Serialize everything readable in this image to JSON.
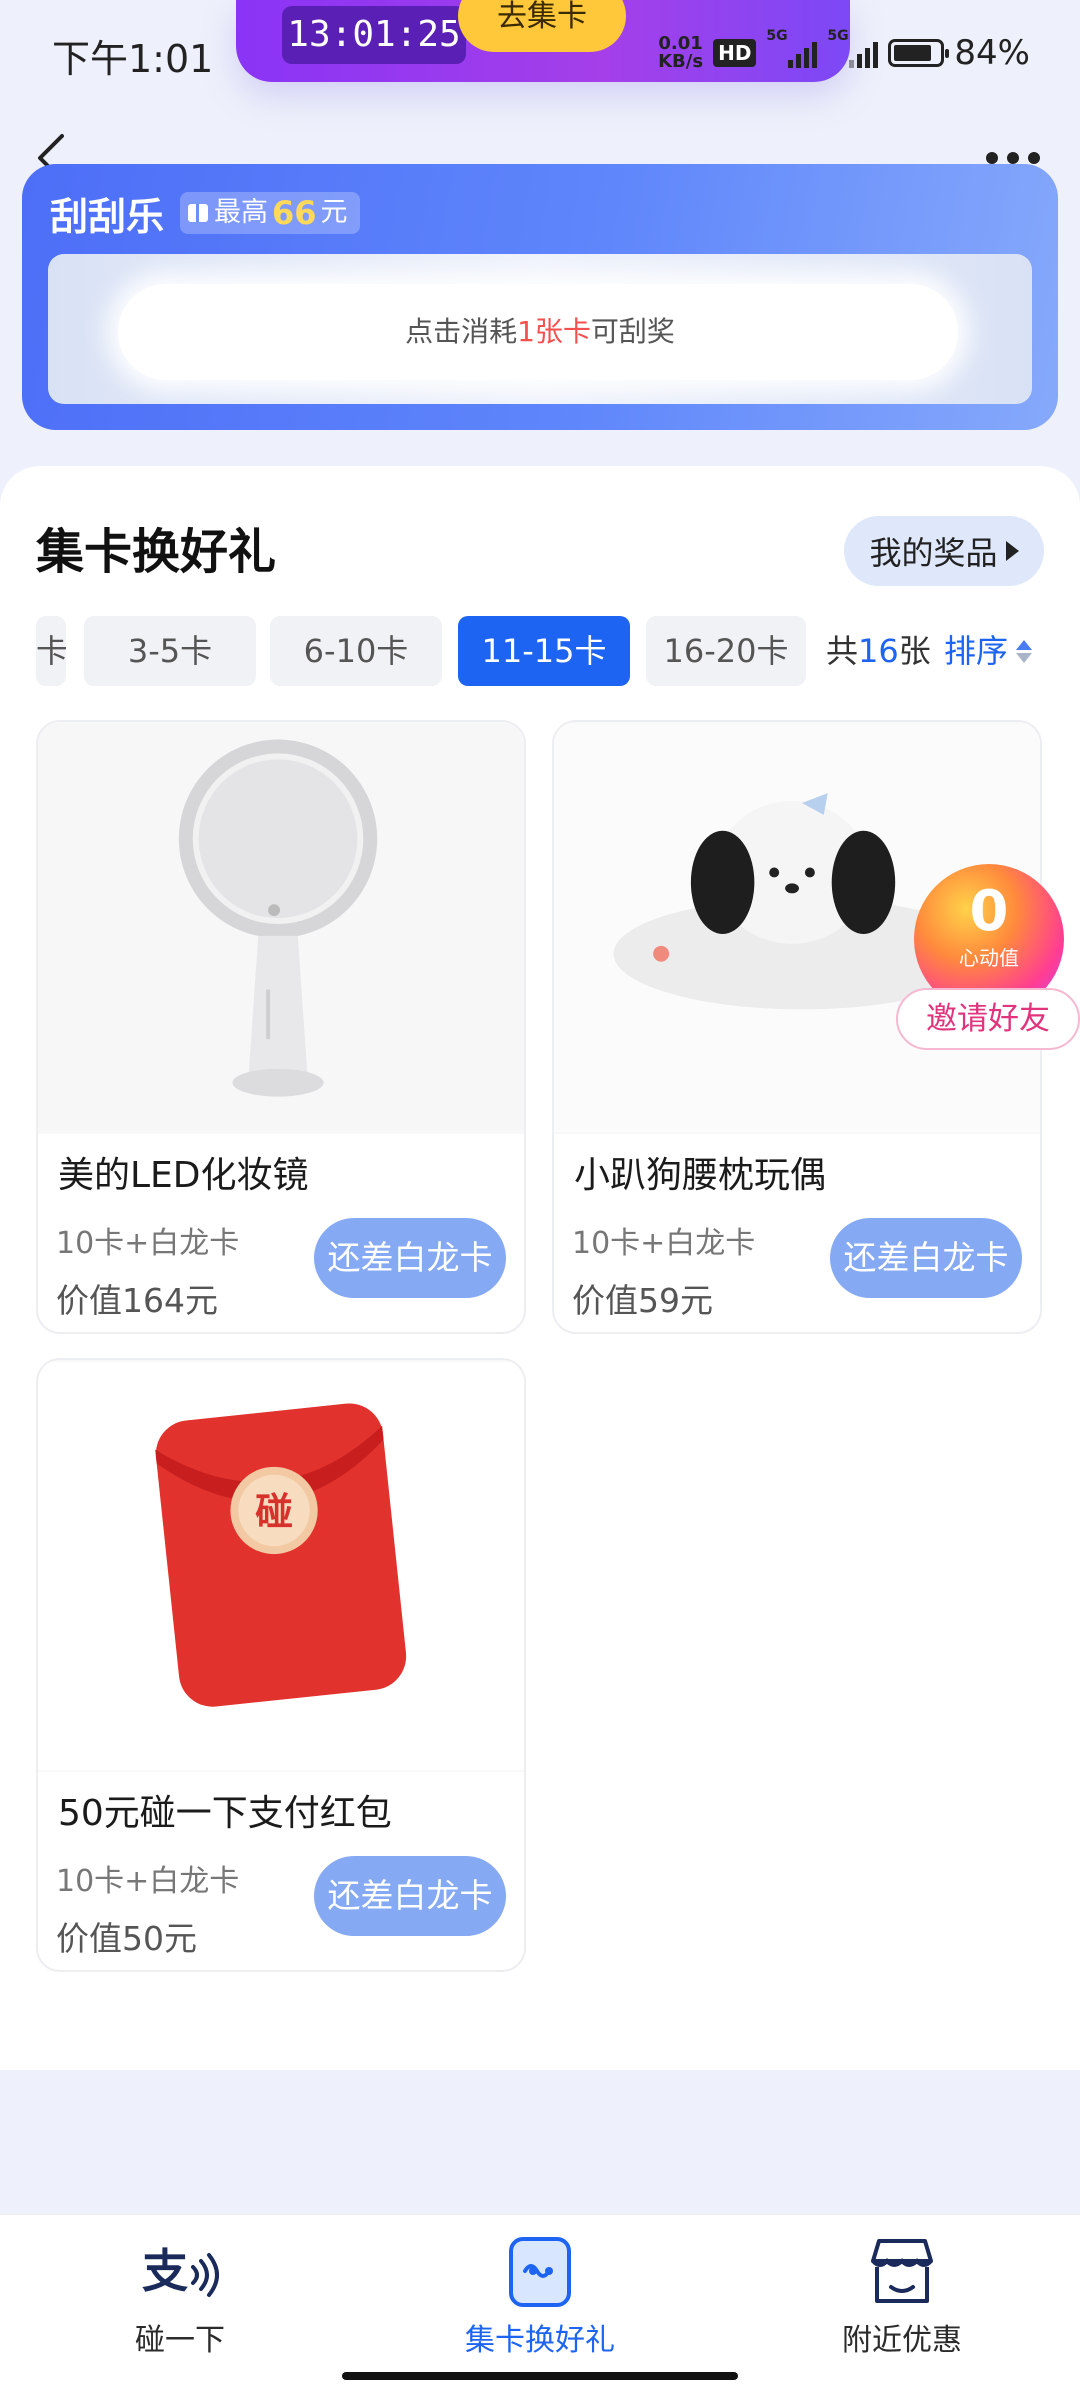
{
  "status_bar": {
    "time": "下午1:01",
    "floating_timer": "13:01:25",
    "floating_action": "去集卡",
    "net_speed_value": "0.01",
    "net_speed_unit": "KB/s",
    "hd_label": "HD",
    "signal_1_label": "5G",
    "signal_2_label": "5G",
    "battery_level": 0.84,
    "battery_text": "84%"
  },
  "scratch": {
    "title": "刮刮乐",
    "badge_prefix": "最高",
    "badge_amount": "66",
    "badge_suffix": "元",
    "hint_prefix": "点击消耗",
    "hint_highlight": "1张卡",
    "hint_suffix": "可刮奖"
  },
  "section": {
    "title": "集卡换好礼",
    "my_prize_label": "我的奖品"
  },
  "tabs": [
    {
      "label": "卡",
      "active": false
    },
    {
      "label": "3-5卡",
      "active": false
    },
    {
      "label": "6-10卡",
      "active": false
    },
    {
      "label": "11-15卡",
      "active": true
    },
    {
      "label": "16-20卡",
      "active": false
    }
  ],
  "count": {
    "prefix": "共",
    "number": "16",
    "suffix": "张"
  },
  "sort_label": "排序",
  "products": [
    {
      "name": "美的LED化妆镜",
      "cost": "10卡+白龙卡",
      "value": "价值164元",
      "button": "还差白龙卡",
      "image": "led-mirror"
    },
    {
      "name": "小趴狗腰枕玩偶",
      "cost": "10卡+白龙卡",
      "value": "价值59元",
      "button": "还差白龙卡",
      "image": "puppy-pillow"
    },
    {
      "name": "50元碰一下支付红包",
      "cost": "10卡+白龙卡",
      "value": "价值50元",
      "button": "还差白龙卡",
      "image": "red-packet"
    }
  ],
  "red_packet_seal": "碰",
  "invite": {
    "value": "0",
    "label": "心动值",
    "button": "邀请好友"
  },
  "bottom_nav": [
    {
      "label": "碰一下",
      "icon": "alipay-touch-icon",
      "active": false
    },
    {
      "label": "集卡换好礼",
      "icon": "card-collect-icon",
      "active": true
    },
    {
      "label": "附近优惠",
      "icon": "nearby-store-icon",
      "active": false
    }
  ],
  "colors": {
    "accent": "#1e64f2",
    "card_button": "#86a9f4",
    "highlight_red": "#f4504f",
    "invite_pink": "#e0357d"
  }
}
